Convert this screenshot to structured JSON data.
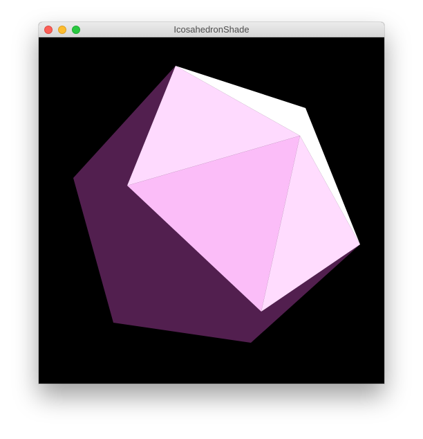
{
  "window": {
    "title": "IcosahedronShade",
    "buttons": {
      "close": "close-button",
      "minimize": "minimize-button",
      "zoom": "zoom-button"
    }
  },
  "viewport": {
    "background": "#000000",
    "object": "icosahedron",
    "colors": {
      "shadow_face": "#521f4f",
      "front_face": "#fbbdf8",
      "side_face": "#ffdcfe",
      "top_face": "#fedafe",
      "highlight_face": "#ffffff"
    }
  }
}
